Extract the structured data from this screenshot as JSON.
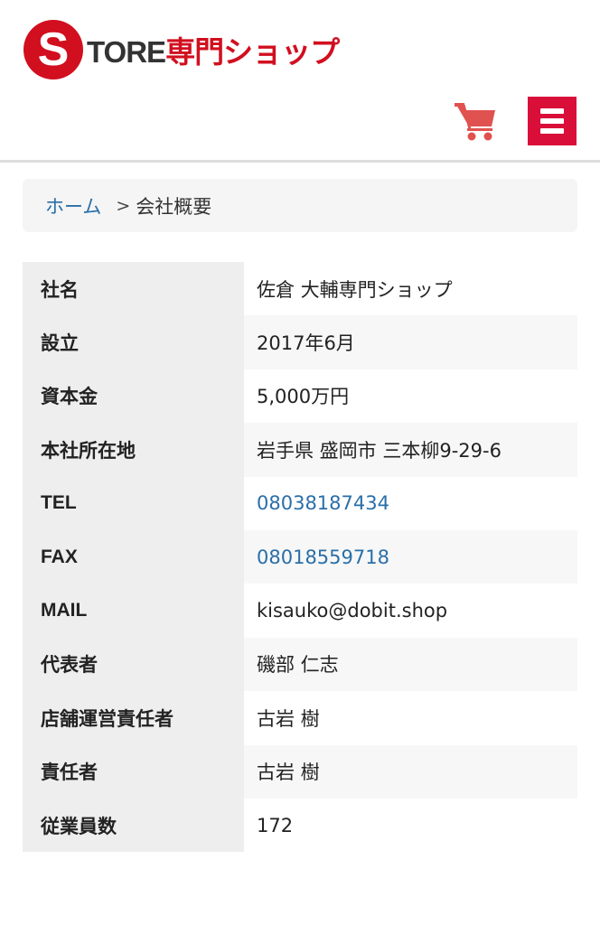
{
  "header": {
    "logo": {
      "letter": "S",
      "text_dark": "TORE",
      "text_red": "専門ショップ"
    },
    "cart_icon": "cart-icon",
    "menu_icon": "hamburger-menu-icon",
    "accent_color": "#d10f1f",
    "menu_color": "#d90f3a",
    "cart_color": "#e0524f"
  },
  "breadcrumb": {
    "home_label": "ホーム",
    "separator": ">",
    "current_label": "会社概要"
  },
  "company_info": {
    "rows": [
      {
        "label": "社名",
        "value": "佐倉 大輔専門ショップ"
      },
      {
        "label": "設立",
        "value": " 2017年6月"
      },
      {
        "label": "資本金",
        "value": " 5,000万円"
      },
      {
        "label": "本社所在地",
        "value": " 岩手県 盛岡市 三本柳9-29-6"
      },
      {
        "label": "TEL",
        "value": "08038187434"
      },
      {
        "label": "FAX",
        "value": "08018559718"
      },
      {
        "label": "MAIL",
        "value": "kisauko@dobit.shop"
      },
      {
        "label": "代表者",
        "value": "磯部 仁志"
      },
      {
        "label": "店舗運営責任者",
        "value": "古岩 樹"
      },
      {
        "label": "責任者",
        "value": "古岩 樹"
      },
      {
        "label": "従業員数",
        "value": "172"
      }
    ]
  }
}
